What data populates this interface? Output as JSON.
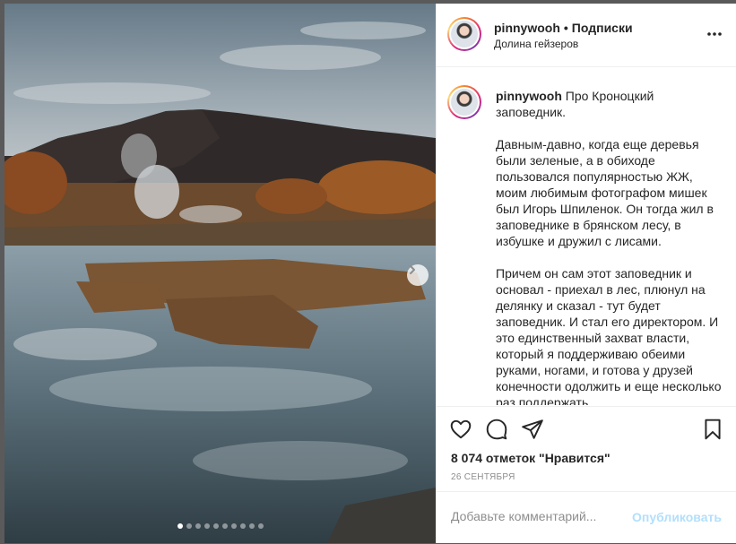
{
  "post": {
    "photo": {
      "next_icon": "chevron-right-icon",
      "carousel": {
        "count": 10,
        "active_index": 0
      }
    }
  },
  "header": {
    "username": "pinnywooh",
    "separator": "•",
    "follow_label": "Подписки",
    "location": "Долина гейзеров",
    "more_icon": "more-horizontal-icon"
  },
  "caption": {
    "username": "pinnywooh",
    "paragraphs": [
      "Про Кроноцкий заповедник.",
      "Давным-давно, когда еще деревья были зеленые, а в обиходе пользовался популярностью ЖЖ, моим любимым фотографом мишек был Игорь Шпиленок. Он тогда жил в заповеднике в брянском лесу, в избушке и дружил с лисами.",
      "Причем он сам этот заповедник и основал - приехал в лес, плюнул на делянку и сказал - тут будет заповедник. И стал его директором. И это единственный захват власти, который я поддерживаю обеими руками, ногами, и готова у друзей конечности одолжить и еще несколько раз поддержать."
    ]
  },
  "actions": {
    "like_icon": "heart-icon",
    "comment_icon": "comment-bubble-icon",
    "share_icon": "paper-plane-icon",
    "save_icon": "bookmark-icon",
    "likes_text": "8 074 отметок \"Нравится\"",
    "date": "26 СЕНТЯБРЯ"
  },
  "comment": {
    "placeholder": "Добавьте комментарий...",
    "publish_label": "Опубликовать"
  },
  "colors": {
    "text": "#262626",
    "muted": "#8e8e8e",
    "publish_disabled": "#b2dffc",
    "border": "#efefef"
  }
}
